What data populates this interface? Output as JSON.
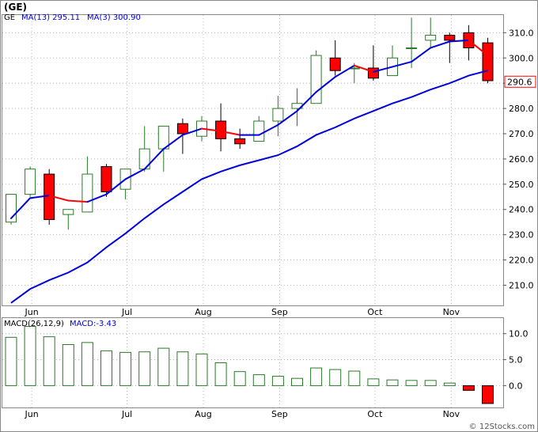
{
  "header": {
    "symbol": "(GE)"
  },
  "footer": {
    "credit": "© 12Stocks.com"
  },
  "colors": {
    "up": "#2a7a2a",
    "down_fill": "#ff0000",
    "ma_long": "#0000dd",
    "ma_short_up": "#0000dd",
    "ma_short_down": "#ff0000",
    "grid": "#aaaaaa",
    "price_badge_border": "#ff0000"
  },
  "chart_data": [
    {
      "type": "candlestick",
      "legend": [
        {
          "label": "GE",
          "color": "#000000"
        },
        {
          "label": "MA(13)",
          "value": "295.11",
          "color": "#0000dd"
        },
        {
          "label": "MA(3)",
          "value": "300.90",
          "color": "#0000dd"
        }
      ],
      "last_price_label": "290.6",
      "ylim": [
        202,
        317
      ],
      "yticks": [
        210,
        220,
        230,
        240,
        250,
        260,
        270,
        280,
        290,
        300,
        310
      ],
      "ytick_labels": [
        "210.0",
        "220.0",
        "230.0",
        "240.0",
        "250.0",
        "260.0",
        "270.0",
        "280.0",
        "290.0",
        "300.0",
        "310.0"
      ],
      "xticks": [
        {
          "label": "Jun",
          "index": 1
        },
        {
          "label": "Jul",
          "index": 6
        },
        {
          "label": "Aug",
          "index": 10
        },
        {
          "label": "Sep",
          "index": 14
        },
        {
          "label": "Oct",
          "index": 19
        },
        {
          "label": "Nov",
          "index": 23
        }
      ],
      "candles": [
        {
          "o": 235,
          "h": 246,
          "l": 234,
          "c": 246
        },
        {
          "o": 246,
          "h": 257,
          "l": 245,
          "c": 256
        },
        {
          "o": 254,
          "h": 256,
          "l": 234,
          "c": 236
        },
        {
          "o": 238,
          "h": 240,
          "l": 232,
          "c": 240
        },
        {
          "o": 239,
          "h": 261,
          "l": 239,
          "c": 254
        },
        {
          "o": 257,
          "h": 258,
          "l": 245,
          "c": 247
        },
        {
          "o": 248,
          "h": 256,
          "l": 244,
          "c": 256
        },
        {
          "o": 256,
          "h": 273,
          "l": 255,
          "c": 264
        },
        {
          "o": 264,
          "h": 273,
          "l": 255,
          "c": 273
        },
        {
          "o": 274,
          "h": 276,
          "l": 262,
          "c": 270
        },
        {
          "o": 269,
          "h": 277,
          "l": 267,
          "c": 275
        },
        {
          "o": 275,
          "h": 282,
          "l": 263,
          "c": 268
        },
        {
          "o": 268,
          "h": 272,
          "l": 264,
          "c": 266
        },
        {
          "o": 267,
          "h": 277,
          "l": 267,
          "c": 275
        },
        {
          "o": 275,
          "h": 285,
          "l": 269,
          "c": 280
        },
        {
          "o": 280,
          "h": 288,
          "l": 273,
          "c": 282
        },
        {
          "o": 282,
          "h": 303,
          "l": 282,
          "c": 301
        },
        {
          "o": 300,
          "h": 307,
          "l": 293,
          "c": 295
        },
        {
          "o": 296,
          "h": 298,
          "l": 290,
          "c": 296
        },
        {
          "o": 296,
          "h": 305,
          "l": 291,
          "c": 292
        },
        {
          "o": 293,
          "h": 305,
          "l": 293,
          "c": 300
        },
        {
          "o": 304,
          "h": 316,
          "l": 296,
          "c": 304
        },
        {
          "o": 307,
          "h": 316,
          "l": 304,
          "c": 309
        },
        {
          "o": 309,
          "h": 310,
          "l": 298,
          "c": 307
        },
        {
          "o": 310,
          "h": 313,
          "l": 299,
          "c": 304
        },
        {
          "o": 306,
          "h": 308,
          "l": 290,
          "c": 291
        }
      ],
      "ma_long": [
        203,
        208.5,
        212,
        215,
        219,
        225,
        230.5,
        236.5,
        242,
        247,
        252,
        255,
        257.5,
        259.5,
        261.5,
        265,
        269.5,
        272.5,
        276,
        279,
        282,
        284.5,
        287.5,
        290,
        293,
        295
      ],
      "ma_short": [
        236.5,
        244.5,
        245.5,
        243.5,
        243,
        246,
        252,
        256,
        264,
        269.5,
        272,
        271,
        269.5,
        269.5,
        273.5,
        279,
        286.5,
        292.5,
        297,
        294.5,
        296.5,
        298.5,
        304,
        306.5,
        307,
        301
      ]
    },
    {
      "type": "bar",
      "legend": [
        {
          "label": "MACD(26,12,9)",
          "color": "#000000"
        },
        {
          "label": "MACD:-3.43",
          "color": "#0000dd"
        }
      ],
      "ylim": [
        -4.2,
        13
      ],
      "yticks": [
        0,
        5,
        10
      ],
      "ytick_labels": [
        "0.0",
        "5.0",
        "10.0"
      ],
      "xticks": [
        {
          "label": "Jun",
          "index": 1
        },
        {
          "label": "Jul",
          "index": 6
        },
        {
          "label": "Aug",
          "index": 10
        },
        {
          "label": "Sep",
          "index": 14
        },
        {
          "label": "Oct",
          "index": 19
        },
        {
          "label": "Nov",
          "index": 23
        }
      ],
      "values": [
        9.3,
        11.4,
        9.4,
        7.9,
        8.3,
        6.7,
        6.4,
        6.5,
        7.2,
        6.5,
        6.1,
        4.4,
        2.7,
        2.1,
        1.8,
        1.4,
        3.4,
        3.1,
        2.8,
        1.3,
        1.1,
        1.0,
        1.0,
        0.5,
        -0.9,
        -3.43
      ]
    }
  ]
}
